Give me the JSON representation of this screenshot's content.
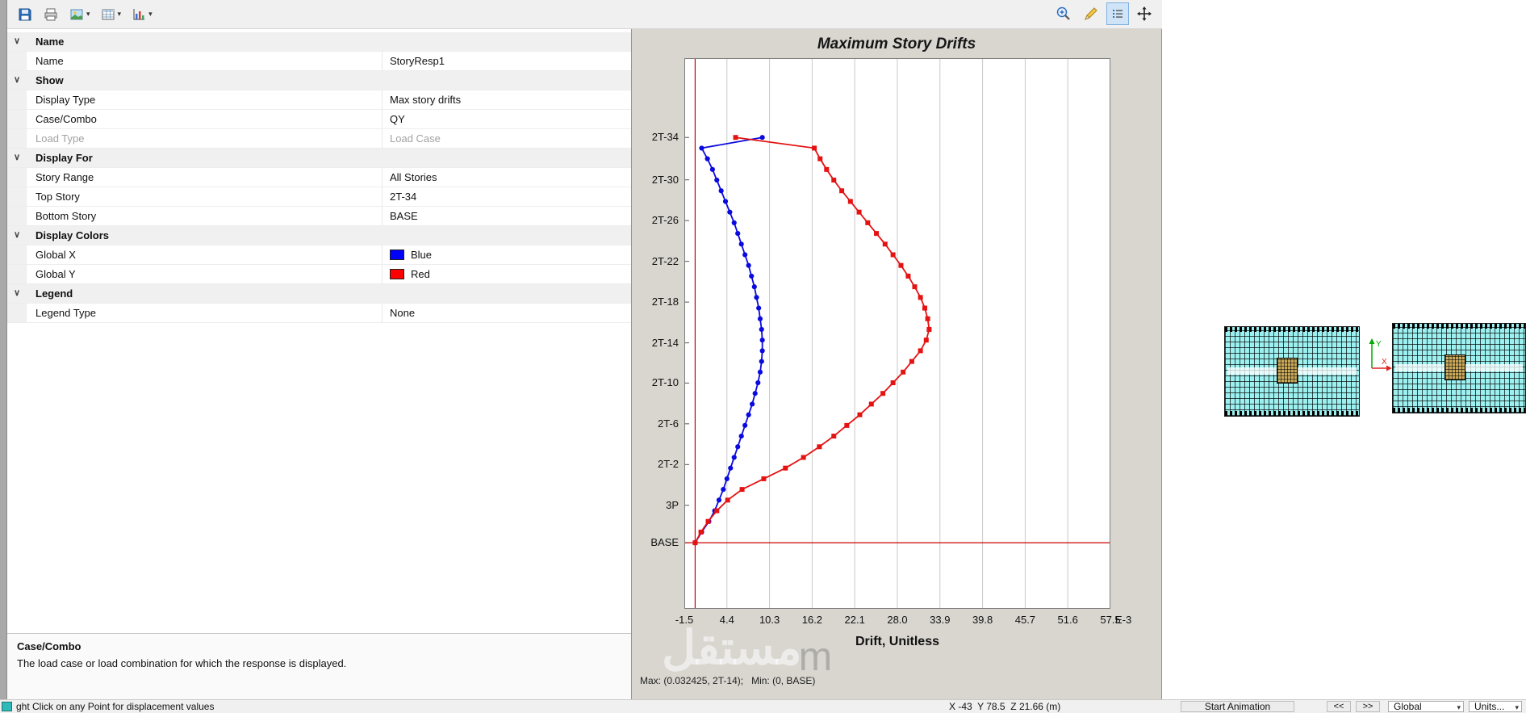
{
  "icons": {
    "dropdown_arrow": "▾",
    "chevron_down": "∨"
  },
  "toolbar": {
    "left_buttons": [
      "save",
      "print",
      "export-image",
      "show-tables",
      "show-plots"
    ],
    "right_buttons": [
      "zoom",
      "edit-pen",
      "details-list",
      "pan"
    ]
  },
  "property_grid": {
    "rows": [
      {
        "type": "section",
        "label": "Name"
      },
      {
        "type": "row",
        "label": "Name",
        "value": "StoryResp1"
      },
      {
        "type": "section",
        "label": "Show"
      },
      {
        "type": "row",
        "label": "Display Type",
        "value": "Max story drifts"
      },
      {
        "type": "row",
        "label": "Case/Combo",
        "value": "QY"
      },
      {
        "type": "row",
        "label": "Load Type",
        "value": "Load Case",
        "disabled": true
      },
      {
        "type": "section",
        "label": "Display For"
      },
      {
        "type": "row",
        "label": "Story Range",
        "value": "All Stories"
      },
      {
        "type": "row",
        "label": "Top Story",
        "value": "2T-34"
      },
      {
        "type": "row",
        "label": "Bottom Story",
        "value": "BASE"
      },
      {
        "type": "section",
        "label": "Display Colors"
      },
      {
        "type": "row",
        "label": "Global X",
        "value": "Blue",
        "swatch": "#0000ff"
      },
      {
        "type": "row",
        "label": "Global Y",
        "value": "Red",
        "swatch": "#ff0000"
      },
      {
        "type": "section",
        "label": "Legend"
      },
      {
        "type": "row",
        "label": "Legend Type",
        "value": "None"
      }
    ]
  },
  "description": {
    "title": "Case/Combo",
    "text": "The load case or load combination for which the response is displayed."
  },
  "chart_data": {
    "type": "line",
    "title": "Maximum Story Drifts",
    "xlabel": "Drift, Unitless",
    "x_suffix": "E-3",
    "xlim": [
      -1.5,
      57.5
    ],
    "x_ticks": [
      -1.5,
      4.4,
      10.3,
      16.2,
      22.1,
      28.0,
      33.9,
      39.8,
      45.7,
      51.6,
      57.5
    ],
    "x_tick_labels": [
      "-1.5",
      "4.4",
      "10.3",
      "16.2",
      "22.1",
      "28.0",
      "33.9",
      "39.8",
      "45.7",
      "51.6",
      "57.5"
    ],
    "stories": [
      "BASE",
      "3P",
      "2T-2",
      "2T-6",
      "2T-10",
      "2T-14",
      "2T-18",
      "2T-22",
      "2T-26",
      "2T-30",
      "2T-34"
    ],
    "y_label_fractions": [
      0.88,
      0.812,
      0.738,
      0.664,
      0.59,
      0.517,
      0.443,
      0.369,
      0.295,
      0.221,
      0.144
    ],
    "series_span": {
      "bottom": 0.88,
      "top": 0.144
    },
    "axis_color": "#cc0000",
    "grid": true,
    "legend": "none",
    "series": [
      {
        "name": "Global X",
        "color": "#0a0adf",
        "marker": "circle",
        "values": [
          0,
          0.9,
          1.9,
          2.7,
          3.3,
          3.9,
          4.4,
          4.9,
          5.4,
          5.9,
          6.4,
          6.9,
          7.4,
          7.9,
          8.3,
          8.7,
          9.0,
          9.2,
          9.3,
          9.3,
          9.2,
          9.0,
          8.8,
          8.5,
          8.2,
          7.8,
          7.4,
          6.9,
          6.4,
          5.9,
          5.4,
          4.8,
          4.2,
          3.6,
          3.0,
          2.4,
          1.7,
          0.9,
          9.3
        ]
      },
      {
        "name": "Global Y",
        "color": "#e51212",
        "marker": "square",
        "values": [
          0,
          0.8,
          1.8,
          3.0,
          4.5,
          6.5,
          9.5,
          12.5,
          15.0,
          17.2,
          19.2,
          21.0,
          22.8,
          24.4,
          26.0,
          27.4,
          28.8,
          30.0,
          31.2,
          32.0,
          32.4,
          32.2,
          31.8,
          31.2,
          30.4,
          29.5,
          28.5,
          27.4,
          26.3,
          25.1,
          23.9,
          22.7,
          21.5,
          20.3,
          19.2,
          18.2,
          17.3,
          16.5,
          5.6
        ]
      }
    ],
    "footer": "Max: (0.032425, 2T-14);   Min: (0, BASE)"
  },
  "right_panel": {
    "axis_x": "X",
    "axis_y": "Y"
  },
  "status_bar": {
    "hint": "ght Click on any Point for displacement values",
    "coords": "X -43  Y 78.5  Z 21.66 (m)",
    "animation": "Start Animation",
    "prev": "<<",
    "next": ">>",
    "csys": "Global",
    "units": "Units..."
  },
  "watermark": {
    "text": "مستقل",
    "letter": "m"
  }
}
